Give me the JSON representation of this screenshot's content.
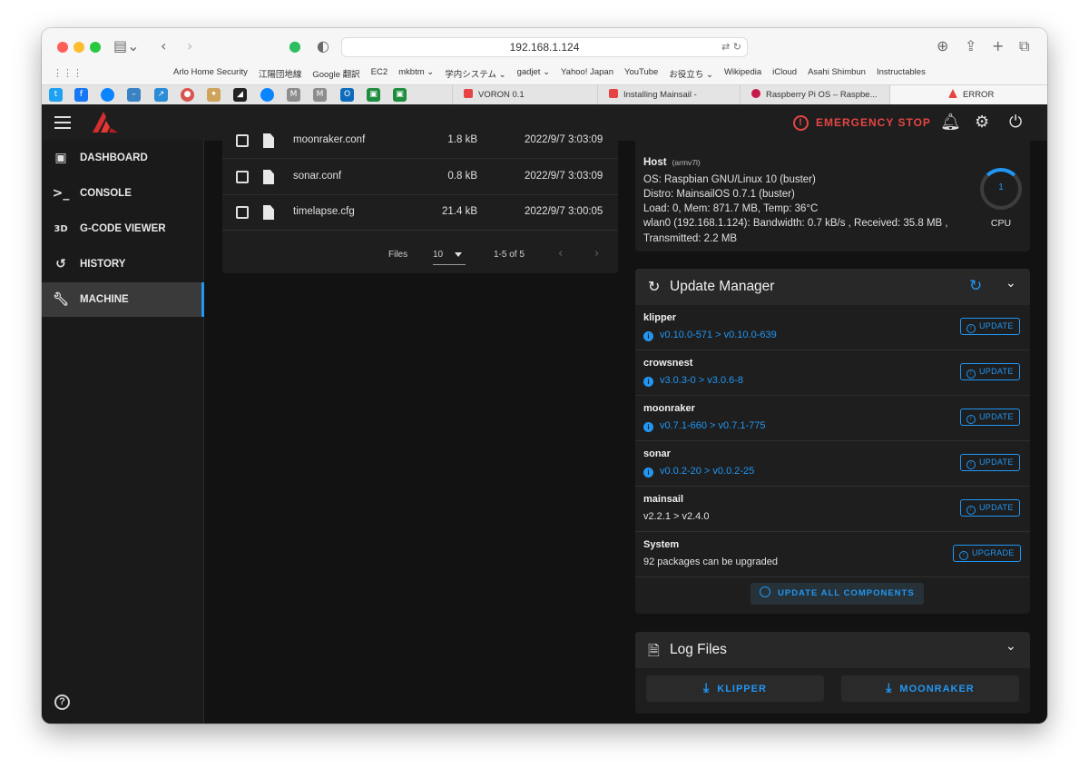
{
  "browser": {
    "url": "192.168.1.124",
    "bookmarks": [
      "Arlo Home Security",
      "江陽団地線",
      "Google 翻訳",
      "EC2",
      "mkbtm ⌄",
      "学内システム ⌄",
      "gadjet ⌄",
      "Yahoo! Japan",
      "YouTube",
      "お役立ち ⌄",
      "Wikipedia",
      "iCloud",
      "Asahi Shimbun",
      "Instructables"
    ],
    "tabs": [
      {
        "title": "VORON 0.1"
      },
      {
        "title": "Installing Mainsail -"
      },
      {
        "title": "Raspberry Pi OS – Raspbe..."
      },
      {
        "title": "ERROR"
      }
    ]
  },
  "appbar": {
    "emergency_stop": "EMERGENCY STOP"
  },
  "sidebar": {
    "items": [
      {
        "label": "DASHBOARD",
        "icon": "monitor-dashboard-icon"
      },
      {
        "label": "CONSOLE",
        "icon": "console-icon"
      },
      {
        "label": "G-CODE VIEWER",
        "icon": "3d-icon"
      },
      {
        "label": "HISTORY",
        "icon": "history-icon"
      },
      {
        "label": "MACHINE",
        "icon": "wrench-icon"
      }
    ],
    "active": "MACHINE"
  },
  "files": {
    "rows": [
      {
        "name": "moonraker.conf",
        "size": "1.8 kB",
        "date": "2022/9/7 3:03:09"
      },
      {
        "name": "sonar.conf",
        "size": "0.8 kB",
        "date": "2022/9/7 3:03:09"
      },
      {
        "name": "timelapse.cfg",
        "size": "21.4 kB",
        "date": "2022/9/7 3:00:05"
      }
    ],
    "pager": {
      "label": "Files",
      "per_page": "10",
      "range": "1-5 of 5"
    }
  },
  "host": {
    "title": "Host",
    "arch": "(armv7l)",
    "lines": [
      "OS: Raspbian GNU/Linux 10 (buster)",
      "Distro: MainsailOS 0.7.1 (buster)",
      "Load: 0, Mem: 871.7 MB, Temp: 36°C",
      "wlan0 (192.168.1.124): Bandwidth: 0.7 kB/s , Received: 35.8 MB ,",
      "Transmitted: 2.2 MB"
    ],
    "cpu_value": "1",
    "cpu_label": "CPU"
  },
  "update_manager": {
    "title": "Update Manager",
    "rows": [
      {
        "name": "klipper",
        "version": "v0.10.0-571 > v0.10.0-639",
        "info": true,
        "button": "UPDATE"
      },
      {
        "name": "crowsnest",
        "version": "v3.0.3-0 > v3.0.6-8",
        "info": true,
        "button": "UPDATE"
      },
      {
        "name": "moonraker",
        "version": "v0.7.1-660 > v0.7.1-775",
        "info": true,
        "button": "UPDATE"
      },
      {
        "name": "sonar",
        "version": "v0.0.2-20 > v0.0.2-25",
        "info": true,
        "button": "UPDATE"
      },
      {
        "name": "mainsail",
        "version": "v2.2.1 > v2.4.0",
        "info": false,
        "button": "UPDATE"
      },
      {
        "name": "System",
        "version": "92 packages can be upgraded",
        "info": false,
        "button": "UPGRADE"
      }
    ],
    "update_all": "UPDATE ALL COMPONENTS"
  },
  "log_files": {
    "title": "Log Files",
    "buttons": [
      "KLIPPER",
      "MOONRAKER"
    ]
  },
  "colors": {
    "accent": "#2196f3",
    "danger": "#e64444",
    "background": "#121212",
    "panel": "#1e1e1e"
  }
}
